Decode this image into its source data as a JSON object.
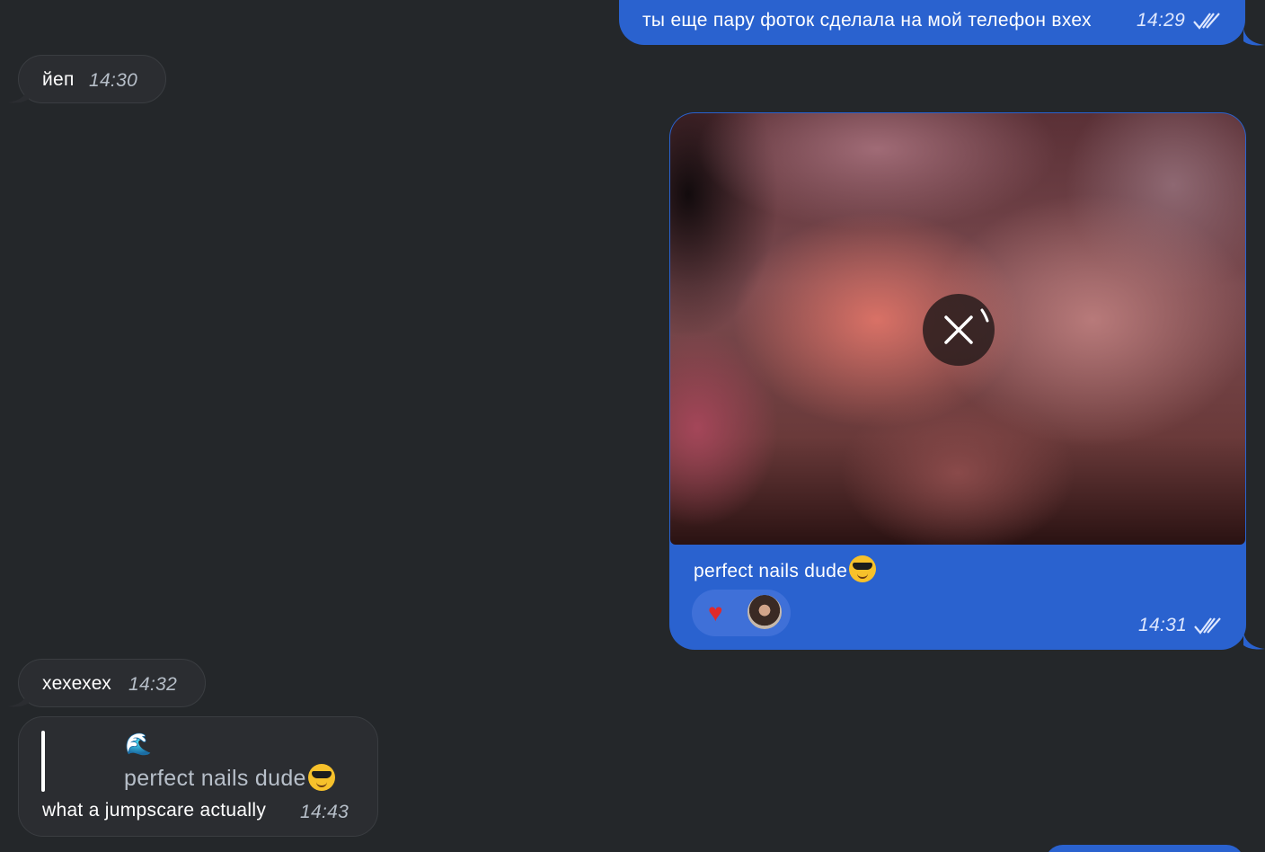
{
  "messages": [
    {
      "direction": "out",
      "text": "ты еще пару фоток сделала на мой телефон вхех",
      "time": "14:29",
      "status": "read"
    },
    {
      "direction": "in",
      "text": "йеп",
      "time": "14:30"
    },
    {
      "direction": "out",
      "type": "photo",
      "caption": "perfect nails dude",
      "caption_emoji": "sunglasses-face-icon",
      "time": "14:31",
      "status": "read",
      "reactions": {
        "emoji": "♥",
        "reactor": "avatar"
      }
    },
    {
      "direction": "in",
      "text": "хехехех",
      "time": "14:32"
    },
    {
      "direction": "in",
      "reply_to": {
        "emoji": "🌊",
        "text": "perfect nails dude"
      },
      "text": "what a jumpscare actually",
      "time": "14:43"
    }
  ],
  "colors": {
    "background": "#24272a",
    "incoming_bubble": "#2b2d31",
    "outgoing_bubble": "#2a62cf"
  }
}
